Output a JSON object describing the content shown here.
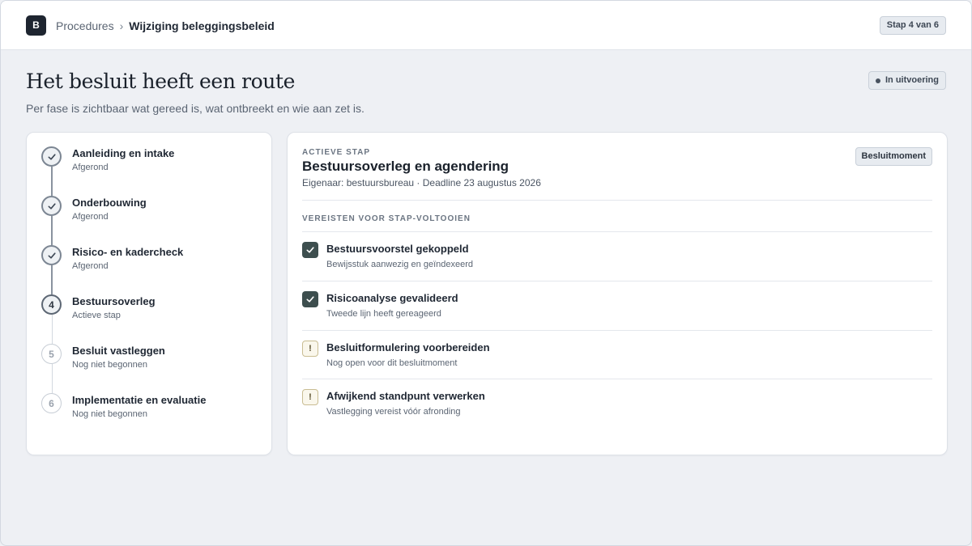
{
  "header": {
    "logo_letter": "B",
    "breadcrumb_root": "Procedures",
    "breadcrumb_separator": "›",
    "breadcrumb_current": "Wijziging beleggingsbeleid",
    "step_indicator": "Stap 4 van 6"
  },
  "page": {
    "title": "Het besluit heeft een route",
    "subtitle": "Per fase is zichtbaar wat gereed is, wat ontbreekt en wie aan zet is.",
    "status": "In uitvoering"
  },
  "steps": [
    {
      "number": "1",
      "title": "Aanleiding en intake",
      "status": "Afgerond",
      "state": "done",
      "icon": "check-icon"
    },
    {
      "number": "2",
      "title": "Onderbouwing",
      "status": "Afgerond",
      "state": "done",
      "icon": "check-icon"
    },
    {
      "number": "3",
      "title": "Risico- en kadercheck",
      "status": "Afgerond",
      "state": "done",
      "icon": "check-icon"
    },
    {
      "number": "4",
      "title": "Bestuursoverleg",
      "status": "Actieve stap",
      "state": "active"
    },
    {
      "number": "5",
      "title": "Besluit vastleggen",
      "status": "Nog niet begonnen",
      "state": "pending"
    },
    {
      "number": "6",
      "title": "Implementatie en evaluatie",
      "status": "Nog niet begonnen",
      "state": "pending"
    }
  ],
  "detail": {
    "eyebrow": "ACTIEVE STAP",
    "title": "Bestuursoverleg en agendering",
    "meta": "Eigenaar: bestuursbureau · Deadline 23 augustus 2026",
    "badge": "Besluitmoment",
    "requirements_heading": "VEREISTEN VOOR STAP-VOLTOOIEN",
    "requirements": [
      {
        "title": "Bestuursvoorstel gekoppeld",
        "subtitle": "Bewijsstuk aanwezig en geïndexeerd",
        "state": "done",
        "icon": "checkbox-checked-icon"
      },
      {
        "title": "Risicoanalyse gevalideerd",
        "subtitle": "Tweede lijn heeft gereageerd",
        "state": "done",
        "icon": "checkbox-checked-icon"
      },
      {
        "title": "Besluitformulering voorbereiden",
        "subtitle": "Nog open voor dit besluitmoment",
        "state": "open",
        "icon": "warning-icon",
        "icon_glyph": "!"
      },
      {
        "title": "Afwijkend standpunt verwerken",
        "subtitle": "Vastlegging vereist vóór afronding",
        "state": "open",
        "icon": "warning-icon",
        "icon_glyph": "!"
      }
    ]
  },
  "colors": {
    "background": "#eef0f4",
    "card": "#ffffff",
    "text": "#1f2733",
    "muted": "#5b6573",
    "check_fill": "#3d4e4e",
    "warn_border": "#c9bd93"
  }
}
